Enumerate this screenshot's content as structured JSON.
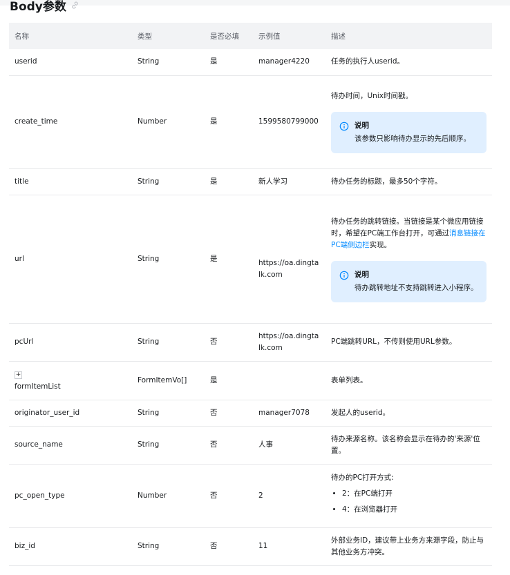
{
  "heading": "Body参数",
  "columns": [
    "名称",
    "类型",
    "是否必填",
    "示例值",
    "描述"
  ],
  "rows": [
    {
      "name": "userid",
      "type": "String",
      "required": "是",
      "example": "manager4220",
      "desc": "任务的执行人userid。"
    },
    {
      "name": "create_time",
      "type": "Number",
      "required": "是",
      "example": "1599580799000",
      "desc": "待办时间，Unix时间戳。",
      "note_title": "说明",
      "note_text": "该参数只影响待办显示的先后顺序。"
    },
    {
      "name": "title",
      "type": "String",
      "required": "是",
      "example": "新人学习",
      "desc": "待办任务的标题，最多50个字符。"
    },
    {
      "name": "url",
      "type": "String",
      "required": "是",
      "example": "https://oa.dingtalk.com",
      "desc_prefix": "待办任务的跳转链接。当链接是某个微应用链接时，希望在PC端工作台打开，可通过",
      "desc_link": "消息链接在PC端侧边栏",
      "desc_suffix": "实现。",
      "note_title": "说明",
      "note_text": "待办跳转地址不支持跳转进入小程序。"
    },
    {
      "name": "pcUrl",
      "type": "String",
      "required": "否",
      "example": "https://oa.dingtalk.com",
      "desc": "PC端跳转URL，不传则使用URL参数。"
    },
    {
      "name": "formItemList",
      "expand": "+",
      "type": "FormItemVo[]",
      "required": "是",
      "example": "",
      "desc": "表单列表。"
    },
    {
      "name": "originator_user_id",
      "type": "String",
      "required": "否",
      "example": "manager7078",
      "desc": "发起人的userid。"
    },
    {
      "name": "source_name",
      "type": "String",
      "required": "否",
      "example": "人事",
      "desc": "待办来源名称。该名称会显示在待办的'来源'位置。"
    },
    {
      "name": "pc_open_type",
      "type": "Number",
      "required": "否",
      "example": "2",
      "desc": "待办的PC打开方式:",
      "options": [
        "2：在PC端打开",
        "4：在浏览器打开"
      ]
    },
    {
      "name": "biz_id",
      "type": "String",
      "required": "否",
      "example": "11",
      "desc": "外部业务ID，建议带上业务方来源字段，防止与其他业务方冲突。"
    }
  ]
}
